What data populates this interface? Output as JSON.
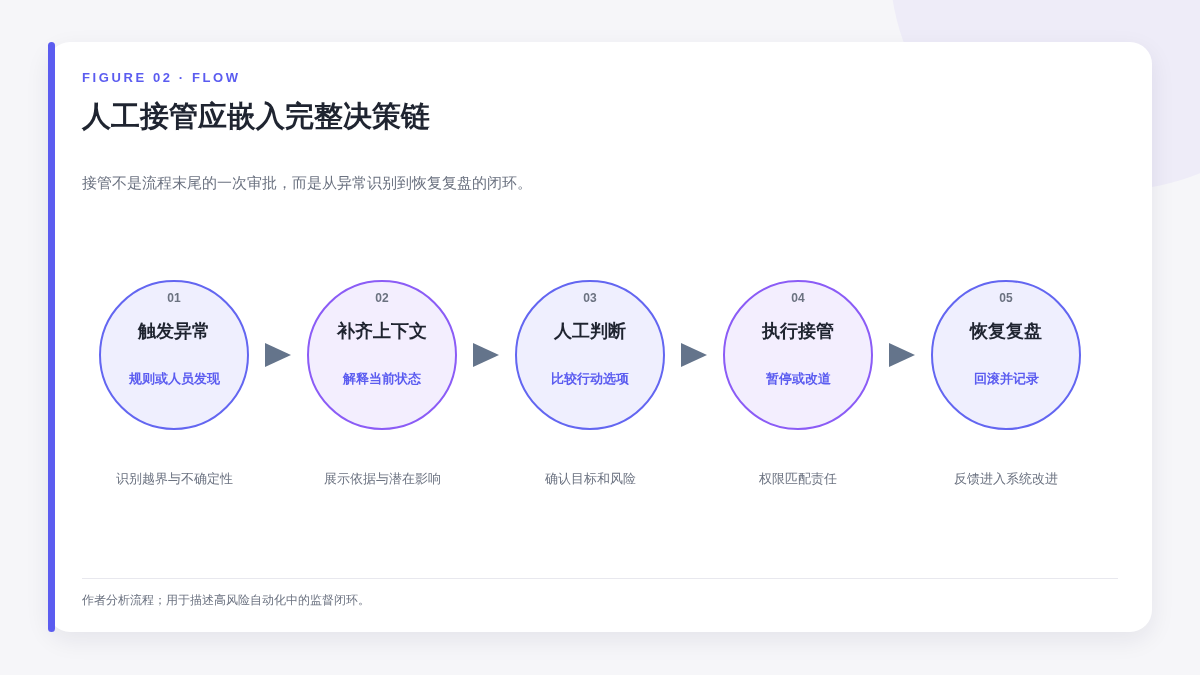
{
  "eyebrow": "FIGURE 02 · FLOW",
  "title": "人工接管应嵌入完整决策链",
  "subtitle": "接管不是流程末尾的一次审批，而是从异常识别到恢复复盘的闭环。",
  "steps": [
    {
      "number": "01",
      "name": "触发异常",
      "detail": "规则或人员发现",
      "caption": "识别越界与不确定性",
      "color": "#6366f1"
    },
    {
      "number": "02",
      "name": "补齐上下文",
      "detail": "解释当前状态",
      "caption": "展示依据与潜在影响",
      "color": "#8b5cf6"
    },
    {
      "number": "03",
      "name": "人工判断",
      "detail": "比较行动选项",
      "caption": "确认目标和风险",
      "color": "#6366f1"
    },
    {
      "number": "04",
      "name": "执行接管",
      "detail": "暂停或改道",
      "caption": "权限匹配责任",
      "color": "#8b5cf6"
    },
    {
      "number": "05",
      "name": "恢复复盘",
      "detail": "回滚并记录",
      "caption": "反馈进入系统改进",
      "color": "#6366f1"
    }
  ],
  "footnote": "作者分析流程；用于描述高风险自动化中的监督闭环。"
}
